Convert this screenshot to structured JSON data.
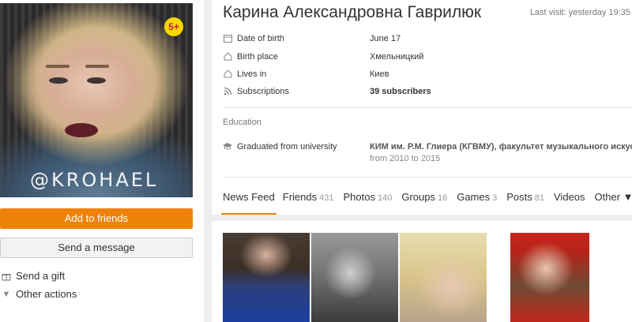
{
  "profile": {
    "name": "Карина Александровна Гаврилюк",
    "last_visit": "Last visit: yesterday 19:35",
    "age_badge": "5+",
    "avatar_watermark": "@KROHAEL"
  },
  "actions": {
    "add_friends": "Add to friends",
    "send_message": "Send a message",
    "send_gift": "Send a gift",
    "other_actions": "Other actions"
  },
  "info": [
    {
      "icon": "calendar-icon",
      "label": "Date of birth",
      "value": "June 17"
    },
    {
      "icon": "house-icon",
      "label": "Birth place",
      "value": "Хмельницкий"
    },
    {
      "icon": "house-icon",
      "label": "Lives in",
      "value": "Киев"
    },
    {
      "icon": "rss-icon",
      "label": "Subscriptions",
      "value": "39 subscribers"
    }
  ],
  "education": {
    "title": "Education",
    "label": "Graduated from university",
    "value": "КИМ им. Р.М. Глиера (КГВМУ), факультет музыкального искусства",
    "years": "from 2010 to 2015"
  },
  "tabs": [
    {
      "label": "News Feed",
      "count": ""
    },
    {
      "label": "Friends",
      "count": "431"
    },
    {
      "label": "Photos",
      "count": "140"
    },
    {
      "label": "Groups",
      "count": "16"
    },
    {
      "label": "Games",
      "count": "3"
    },
    {
      "label": "Posts",
      "count": "81"
    },
    {
      "label": "Videos",
      "count": ""
    },
    {
      "label": "Other ▼",
      "count": ""
    }
  ],
  "colors": {
    "accent": "#ee8208",
    "badge": "#f5d800",
    "background": "#eeeeee"
  }
}
